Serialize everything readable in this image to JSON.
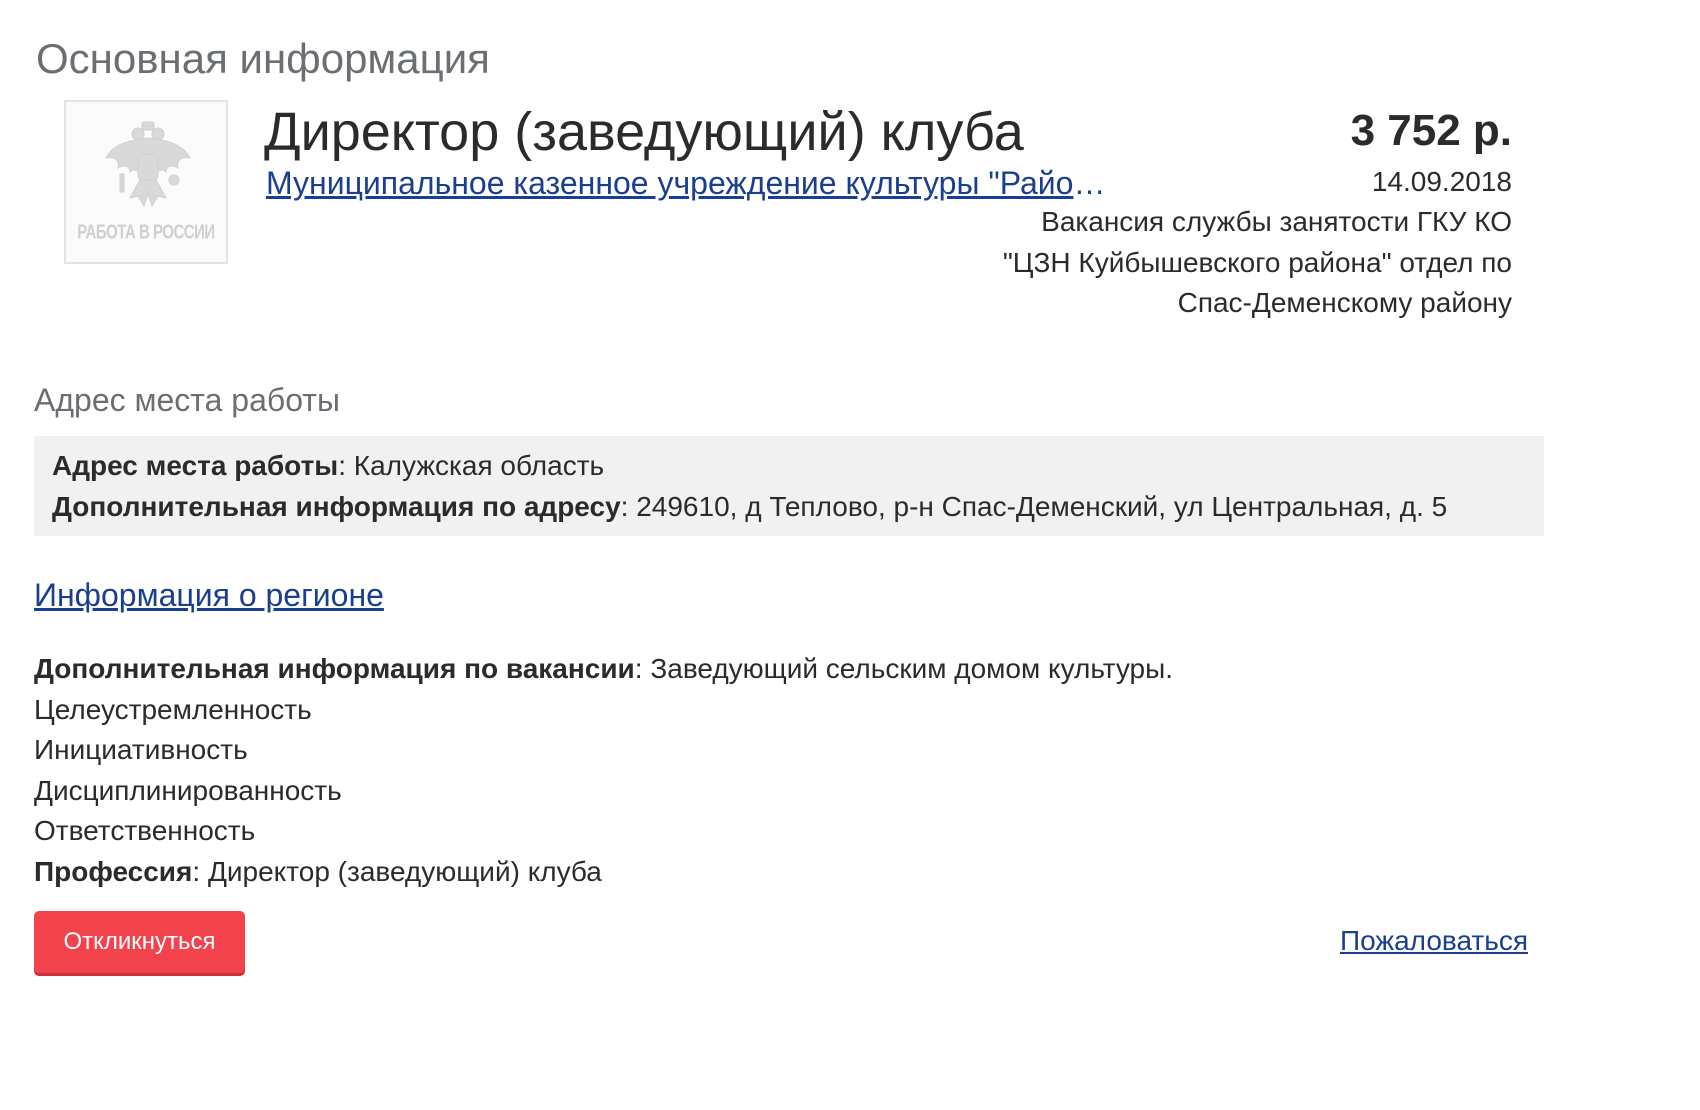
{
  "section_title": "Основная информация",
  "logo": {
    "icon": "double-headed-eagle-emblem",
    "caption": "РАБОТА В РОССИИ"
  },
  "vacancy": {
    "title": "Директор (заведующий) клуба",
    "employer": "Муниципальное казенное учреждение культуры \"Районный дом культуры\"",
    "salary": "3 752 р.",
    "date": "14.09.2018",
    "source": "Вакансия службы занятости ГКУ КО \"ЦЗН Куйбышевского района\" отдел по Спас-Деменскому району"
  },
  "address": {
    "heading": "Адрес места работы",
    "work_address_label": "Адрес места работы",
    "work_address_value": "Калужская область",
    "extra_label": "Дополнительная информация по адресу",
    "extra_value": "249610, д Теплово, р-н Спас-Деменский, ул Центральная, д. 5"
  },
  "region_link": "Информация о регионе",
  "details": {
    "extra_label": "Дополнительная информация по вакансии",
    "extra_value": "Заведующий сельским домом культуры.",
    "lines": [
      "Целеустремленность",
      "Инициативность",
      "Дисциплинированность",
      "Ответственность"
    ],
    "profession_label": "Профессия",
    "profession_value": "Директор (заведующий) клуба"
  },
  "actions": {
    "respond": "Откликнуться",
    "complain": "Пожаловаться"
  },
  "colors": {
    "link": "#1a3f8f",
    "button": "#f2424c",
    "heading_gray": "#6b6f73",
    "address_bg": "#f1f1f1"
  }
}
